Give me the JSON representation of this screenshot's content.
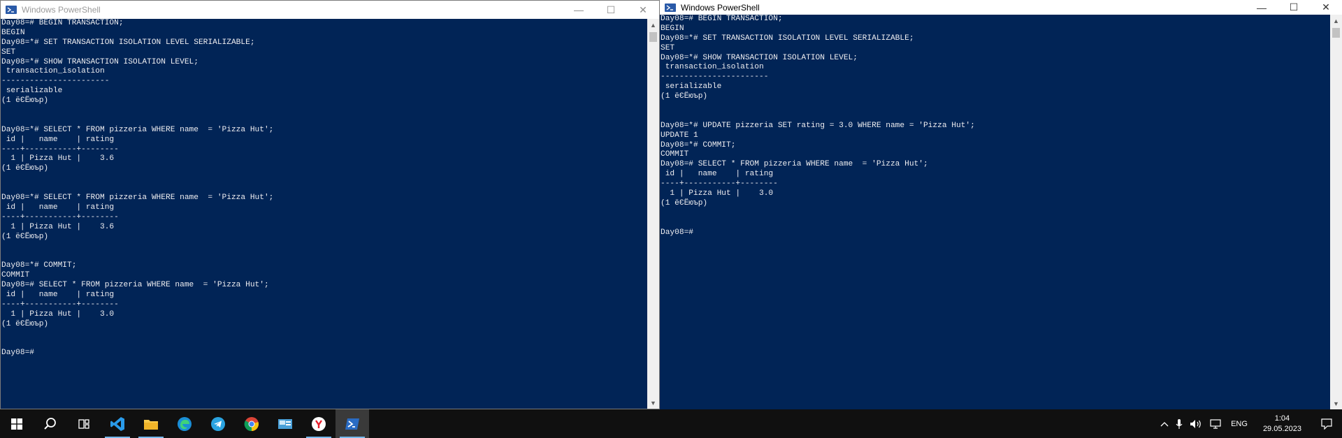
{
  "left_window": {
    "title": "Windows PowerShell",
    "controls": {
      "minimize": "—",
      "maximize": "☐",
      "close": "✕"
    },
    "lines": [
      "Day08=# BEGIN TRANSACTION;",
      "BEGIN",
      "Day08=*# SET TRANSACTION ISOLATION LEVEL SERIALIZABLE;",
      "SET",
      "Day08=*# SHOW TRANSACTION ISOLATION LEVEL;",
      " transaction_isolation",
      "-----------------------",
      " serializable",
      "(1 ёЄЁюър)",
      "",
      "",
      "Day08=*# SELECT * FROM pizzeria WHERE name  = 'Pizza Hut';",
      " id |   name    | rating",
      "----+-----------+--------",
      "  1 | Pizza Hut |    3.6",
      "(1 ёЄЁюър)",
      "",
      "",
      "Day08=*# SELECT * FROM pizzeria WHERE name  = 'Pizza Hut';",
      " id |   name    | rating",
      "----+-----------+--------",
      "  1 | Pizza Hut |    3.6",
      "(1 ёЄЁюър)",
      "",
      "",
      "Day08=*# COMMIT;",
      "COMMIT",
      "Day08=# SELECT * FROM pizzeria WHERE name  = 'Pizza Hut';",
      " id |   name    | rating",
      "----+-----------+--------",
      "  1 | Pizza Hut |    3.0",
      "(1 ёЄЁюър)",
      "",
      "",
      "Day08=#"
    ]
  },
  "right_window": {
    "title": "Windows PowerShell",
    "controls": {
      "minimize": "—",
      "maximize": "☐",
      "close": "✕"
    },
    "lines": [
      "Day08=# BEGIN TRANSACTION;",
      "BEGIN",
      "Day08=*# SET TRANSACTION ISOLATION LEVEL SERIALIZABLE;",
      "SET",
      "Day08=*# SHOW TRANSACTION ISOLATION LEVEL;",
      " transaction_isolation",
      "-----------------------",
      " serializable",
      "(1 ёЄЁюър)",
      "",
      "",
      "Day08=*# UPDATE pizzeria SET rating = 3.0 WHERE name = 'Pizza Hut';",
      "UPDATE 1",
      "Day08=*# COMMIT;",
      "COMMIT",
      "Day08=# SELECT * FROM pizzeria WHERE name  = 'Pizza Hut';",
      " id |   name    | rating",
      "----+-----------+--------",
      "  1 | Pizza Hut |    3.0",
      "(1 ёЄЁюър)",
      "",
      "",
      "Day08=#"
    ]
  },
  "taskbar": {
    "apps": [
      {
        "name": "start",
        "icon": "windows-logo"
      },
      {
        "name": "search",
        "icon": "search-icon"
      },
      {
        "name": "task-view",
        "icon": "task-view-icon"
      },
      {
        "name": "vscode",
        "icon": "vscode-icon",
        "running": true
      },
      {
        "name": "file-explorer",
        "icon": "folder-icon",
        "running": true
      },
      {
        "name": "edge",
        "icon": "edge-icon"
      },
      {
        "name": "telegram",
        "icon": "telegram-icon"
      },
      {
        "name": "chrome",
        "icon": "chrome-icon"
      },
      {
        "name": "control-panel",
        "icon": "control-panel-icon"
      },
      {
        "name": "yandex",
        "icon": "yandex-icon",
        "running": true
      },
      {
        "name": "powershell",
        "icon": "powershell-icon",
        "running": true,
        "active": true
      }
    ],
    "tray": {
      "language": "ENG",
      "time": "1:04",
      "date": "29.05.2023"
    }
  },
  "colors": {
    "console_bg": "#012456",
    "console_fg": "#eeedf0",
    "taskbar_bg": "#101010",
    "accent": "#76b9ed"
  }
}
